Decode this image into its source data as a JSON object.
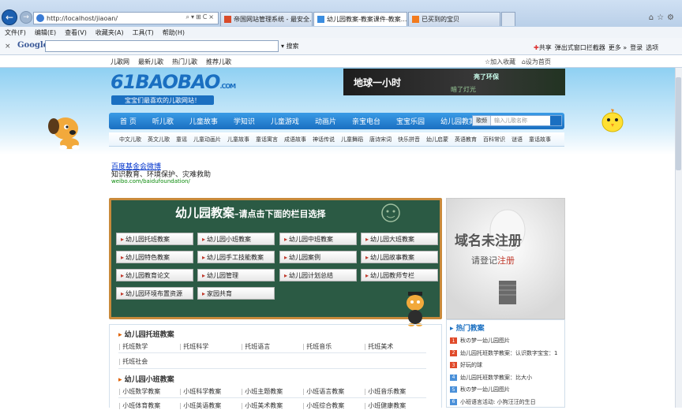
{
  "browser": {
    "address": "http://localhost/jiaoan/",
    "tabs": [
      {
        "label": "帝国网站管理系统 - 最安全...",
        "active": false
      },
      {
        "label": "幼儿园教案-教案课件-教案...",
        "active": true
      },
      {
        "label": "已买到的宝贝",
        "active": false
      }
    ],
    "menu": [
      "文件(F)",
      "编辑(E)",
      "查看(V)",
      "收藏夹(A)",
      "工具(T)",
      "帮助(H)"
    ],
    "toolbar": {
      "engine": "Google",
      "search_label": "搜索",
      "share": "共享",
      "popup_blocker": "弹出式窗口拦截器",
      "more": "更多 »",
      "login": "登录",
      "options": "选项"
    }
  },
  "favbar": {
    "links": [
      "儿歌网",
      "最新儿歌",
      "热门儿歌",
      "推荐儿歌"
    ],
    "add_fav": "加入收藏",
    "set_home": "设为首页"
  },
  "site": {
    "logo_main": "61BAOBAO",
    "logo_com": ".COM",
    "slogan": "宝宝们最喜欢的儿歌网站！",
    "ad": {
      "main": "地球一小时",
      "sub": "亮了环保",
      "sub2": "暗了灯光"
    },
    "nav": [
      "首 页",
      "听儿歌",
      "儿童故事",
      "学知识",
      "儿童游戏",
      "动画片",
      "亲宝电台",
      "宝宝乐园",
      "幼儿园教案"
    ],
    "search_select": "歌频",
    "search_placeholder": "输入儿歌名称",
    "subnav": [
      "中文儿歌",
      "英文儿歌",
      "童谣",
      "儿童动画片",
      "儿童故事",
      "童话寓言",
      "成语故事",
      "神话传说",
      "儿童舞蹈",
      "唐诗宋词",
      "快乐拼音",
      "幼儿启蒙",
      "英语教育",
      "百科常识",
      "谜语",
      "童话故事"
    ]
  },
  "baidu_ad": {
    "title": "百度基金会微博",
    "desc": "知识教育、环境保护、灾难救助",
    "url": "weibo.com/baidufoundation/"
  },
  "board": {
    "title": "幼儿园教案",
    "subtitle": "请点击下面的栏目选择",
    "buttons": [
      "幼儿园托班教案",
      "幼儿园小班教案",
      "幼儿园中班教案",
      "幼儿园大班教案",
      "幼儿园特色教案",
      "幼儿园手工技能教案",
      "幼儿园案例",
      "幼儿园故事教案",
      "幼儿园教育论文",
      "幼儿园管理",
      "幼儿园计划总结",
      "幼儿园教师专栏",
      "幼儿园环境布置资源",
      "家园共育"
    ]
  },
  "domain_ad": {
    "main": "域名未注册",
    "sub": "请登记",
    "sub_red": "注册"
  },
  "sections": [
    {
      "title": "幼儿园托班教案",
      "rows": [
        [
          "托班数学",
          "托班科学",
          "托班语言",
          "托班音乐",
          "托班美术"
        ],
        [
          "托班社会"
        ]
      ]
    },
    {
      "title": "幼儿园小班教案",
      "rows": [
        [
          "小班数学教案",
          "小班科学教案",
          "小班主题教案",
          "小班语言教案",
          "小班音乐教案"
        ],
        [
          "小班体育教案",
          "小班英语教案",
          "小班美术教案",
          "小班综合教案",
          "小班健康教案"
        ]
      ]
    }
  ],
  "hot": {
    "title": "热门教案",
    "items": [
      {
        "n": "1",
        "text": "秋の梦一幼儿园图片",
        "color": "#e04a2a"
      },
      {
        "n": "2",
        "text": "幼儿园托班数学教案：认识数字宝宝：1",
        "color": "#e04a2a"
      },
      {
        "n": "3",
        "text": "好玩的球",
        "color": "#e04a2a"
      },
      {
        "n": "4",
        "text": "幼儿园托班数学教案：比大小",
        "color": "#4a90d9"
      },
      {
        "n": "5",
        "text": "秋の梦一幼儿园图片",
        "color": "#4a90d9"
      },
      {
        "n": "6",
        "text": "小班语言活动: 小狗汪汪的生日",
        "color": "#4a90d9"
      }
    ]
  }
}
